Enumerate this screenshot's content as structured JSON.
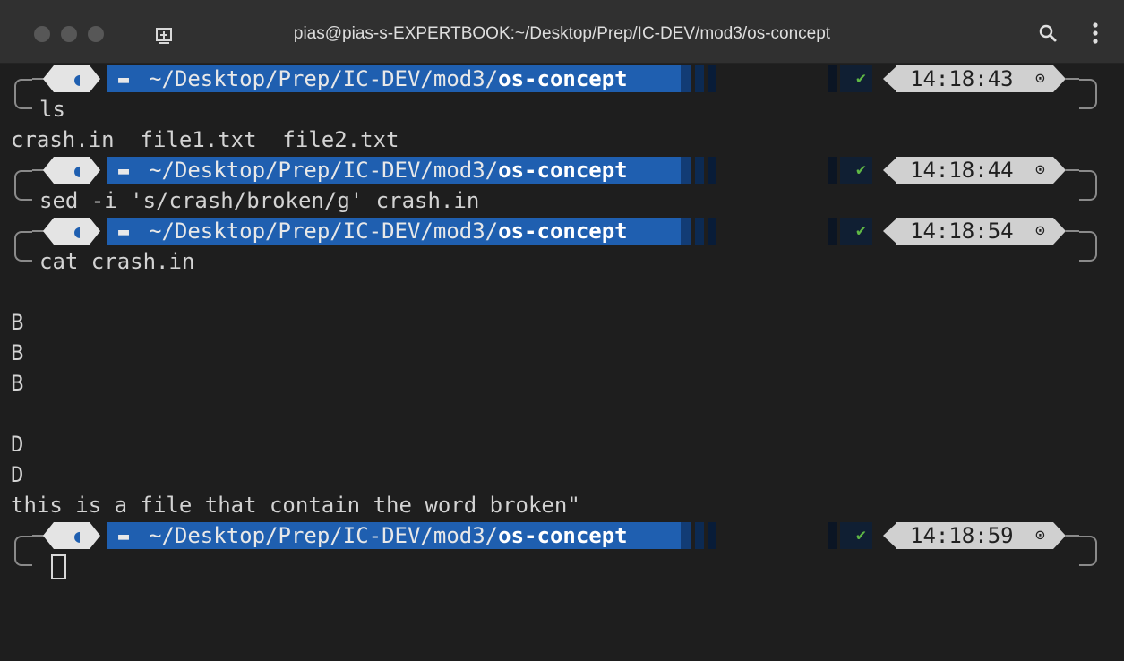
{
  "window": {
    "title": "pias@pias-s-EXPERTBOOK:~/Desktop/Prep/IC-DEV/mod3/os-concept",
    "titlebar_color": "#303030",
    "background": "#1e1e1e",
    "new_tab_icon": "new-tab-icon",
    "search_icon": "search-icon",
    "menu_icon": "kebab-menu-icon"
  },
  "prompt": {
    "os_icon": "◀͡",
    "folder_icon": "▬",
    "path_prefix": "~/Desktop/Prep/IC-DEV/mod3/",
    "path_dir": "os-concept",
    "status_icon": "✔",
    "clock_icon": "⊙",
    "path_color": "#1f5fb0",
    "time_color": "#d0d0d0",
    "status_color": "#5fb845"
  },
  "prompts": [
    {
      "time": "14:18:43",
      "command": "ls"
    },
    {
      "time": "14:18:44",
      "command": "sed -i 's/crash/broken/g' crash.in"
    },
    {
      "time": "14:18:54",
      "command": "cat crash.in"
    },
    {
      "time": "14:18:59",
      "command": ""
    }
  ],
  "output": {
    "ls": "crash.in  file1.txt  file2.txt",
    "cat_lines": [
      "",
      "B",
      "B",
      "B",
      "",
      "D",
      "D",
      "this is a file that contain the word broken\""
    ]
  }
}
